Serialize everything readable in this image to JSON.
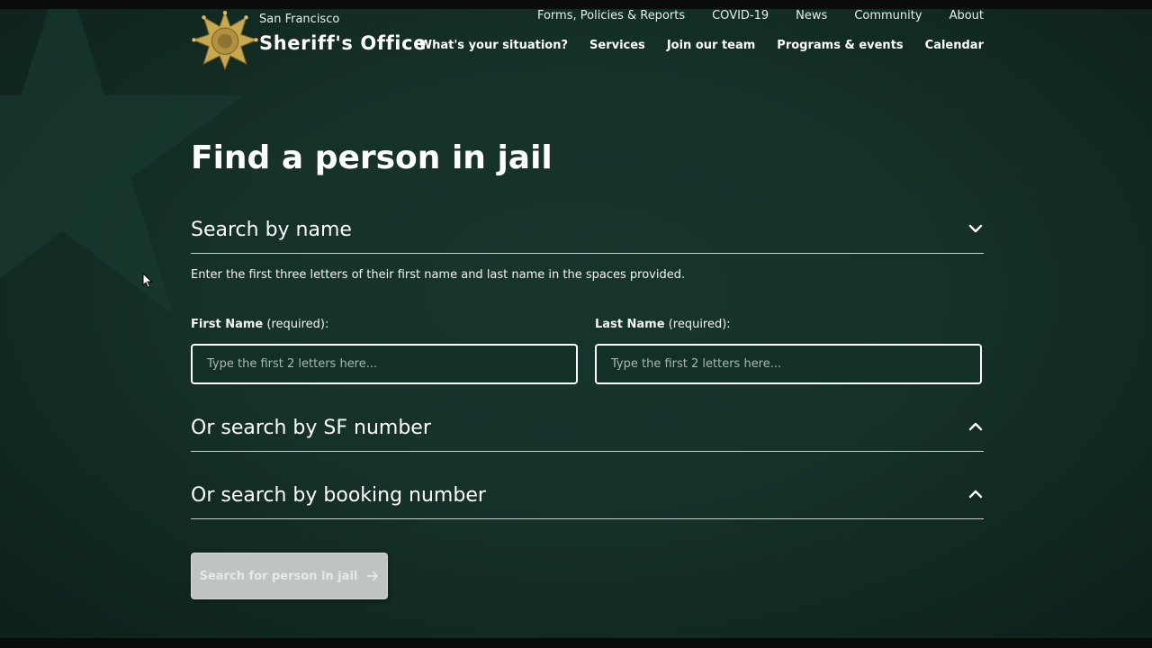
{
  "brand": {
    "city": "San Francisco",
    "office": "Sheriff's Office"
  },
  "nav": {
    "top": [
      "Forms, Policies & Reports",
      "COVID-19",
      "News",
      "Community",
      "About"
    ],
    "main": [
      "What's your situation?",
      "Services",
      "Join our team",
      "Programs & events",
      "Calendar"
    ]
  },
  "page": {
    "title": "Find a person in jail",
    "sections": [
      {
        "label": "Search by name",
        "expanded": true,
        "chevron": "chevron-down-icon"
      },
      {
        "label": "Or search by SF number",
        "expanded": false,
        "chevron": "chevron-up-icon"
      },
      {
        "label": "Or search by booking number",
        "expanded": false,
        "chevron": "chevron-up-icon"
      }
    ],
    "helper": "Enter the first three letters of their first name and last name in the spaces provided.",
    "first_name": {
      "label": "First Name",
      "suffix": " (required):",
      "placeholder": "Type the first 2 letters here...",
      "value": ""
    },
    "last_name": {
      "label": "Last Name",
      "suffix": " (required):",
      "placeholder": "Type the first 2 letters here...",
      "value": ""
    },
    "search_button": {
      "label": "Search for person in jail",
      "icon": "arrow-right-icon"
    }
  },
  "colors": {
    "background": "#153128",
    "text": "#ffffff",
    "button_disabled": "#bfc3c2",
    "badge_gold": "#c9a94f"
  }
}
